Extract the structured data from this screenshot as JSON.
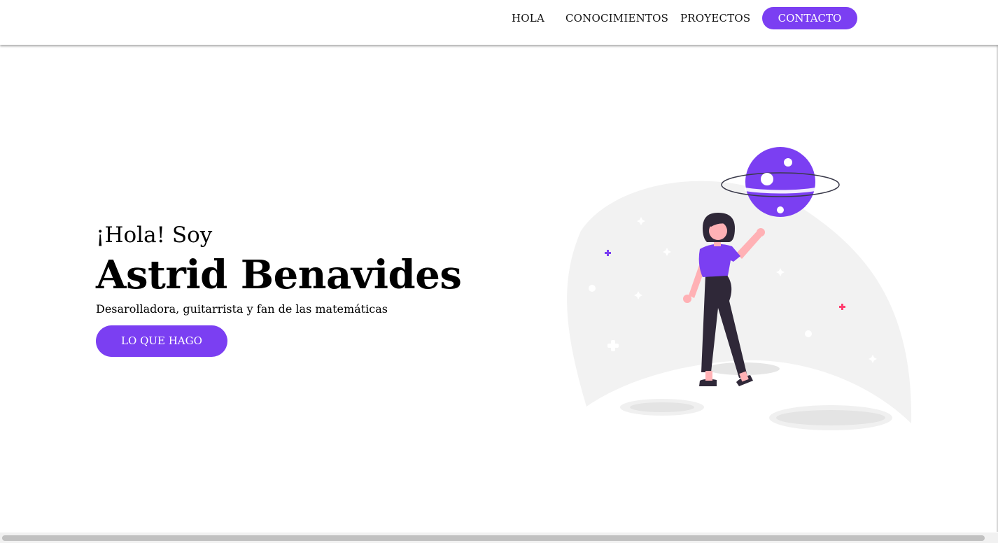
{
  "nav": {
    "items": [
      {
        "label": "HOLA"
      },
      {
        "label": "CONOCIMIENTOS"
      },
      {
        "label": "PROYECTOS"
      }
    ],
    "contact_label": "CONTACTO"
  },
  "hero": {
    "greeting": "¡Hola! Soy",
    "name": "Astrid Benavides",
    "tagline": "Desarolladora, guitarrista y fan de las matemáticas",
    "cta_label": "LO QUE HAGO"
  },
  "colors": {
    "accent": "#7b3ff2",
    "figure_skin": "#ffb1b5",
    "figure_dark": "#2f2838",
    "pink_star": "#ff3d6e",
    "planet_bg": "#f2f2f2"
  },
  "illustration": {
    "icon": "woman-with-planet-illustration"
  }
}
